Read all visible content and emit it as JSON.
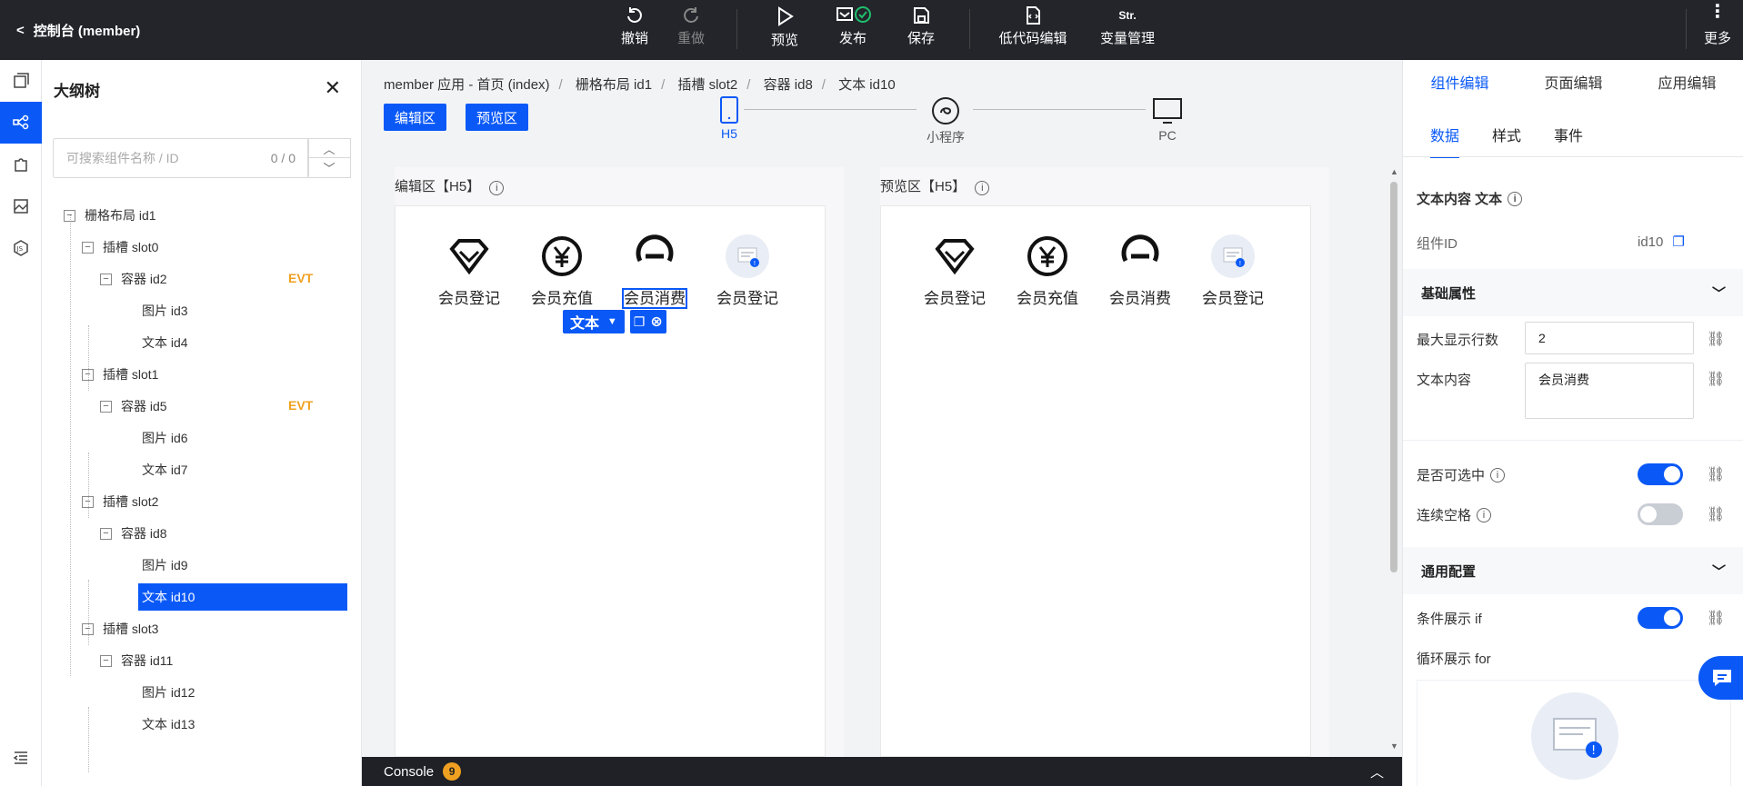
{
  "header": {
    "back_label": "控制台 (member)",
    "tools": {
      "undo": "撤销",
      "redo": "重做",
      "preview": "预览",
      "publish": "发布",
      "save": "保存",
      "lowcode": "低代码编辑",
      "variables": "变量管理",
      "variables_icon_text": "Str.",
      "more": "更多"
    }
  },
  "outline": {
    "title": "大纲树",
    "search_placeholder": "可搜索组件名称 / ID",
    "search_count": "0 / 0",
    "nodes": {
      "root": "栅格布局 id1",
      "slot0": "插槽 slot0",
      "id2": "容器 id2",
      "id3": "图片 id3",
      "id4": "文本 id4",
      "slot1": "插槽 slot1",
      "id5": "容器 id5",
      "id6": "图片 id6",
      "id7": "文本 id7",
      "slot2": "插槽 slot2",
      "id8": "容器 id8",
      "id9": "图片 id9",
      "id10": "文本 id10",
      "slot3": "插槽 slot3",
      "id11": "容器 id11",
      "id12": "图片 id12",
      "id13": "文本 id13"
    },
    "evt_badge": "EVT"
  },
  "canvas": {
    "breadcrumb": [
      "member 应用 - 首页 (index)",
      "栅格布局 id1",
      "插槽 slot2",
      "容器 id8",
      "文本 id10"
    ],
    "edit_btn": "编辑区",
    "preview_btn": "预览区",
    "devices": [
      "H5",
      "小程序",
      "PC"
    ],
    "edit_pane_title": "编辑区【H5】",
    "preview_pane_title": "预览区【H5】",
    "items": [
      "会员登记",
      "会员充值",
      "会员消费",
      "会员登记"
    ],
    "selected_tag": "文本"
  },
  "console": {
    "label": "Console",
    "count": "9"
  },
  "props": {
    "tabs": [
      "组件编辑",
      "页面编辑",
      "应用编辑"
    ],
    "subtabs": [
      "数据",
      "样式",
      "事件"
    ],
    "heading": "文本内容 文本",
    "component_id_label": "组件ID",
    "component_id": "id10",
    "basic_section": "基础属性",
    "max_lines_label": "最大显示行数",
    "max_lines_value": "2",
    "text_content_label": "文本内容",
    "text_content_value": "会员消费",
    "selectable_label": "是否可选中",
    "continuous_space_label": "连续空格",
    "general_section": "通用配置",
    "condition_label": "条件展示 if",
    "loop_label": "循环展示 for"
  },
  "colors": {
    "accent": "#0a59f7",
    "topbar": "#23252b",
    "evt": "#f0a020"
  }
}
